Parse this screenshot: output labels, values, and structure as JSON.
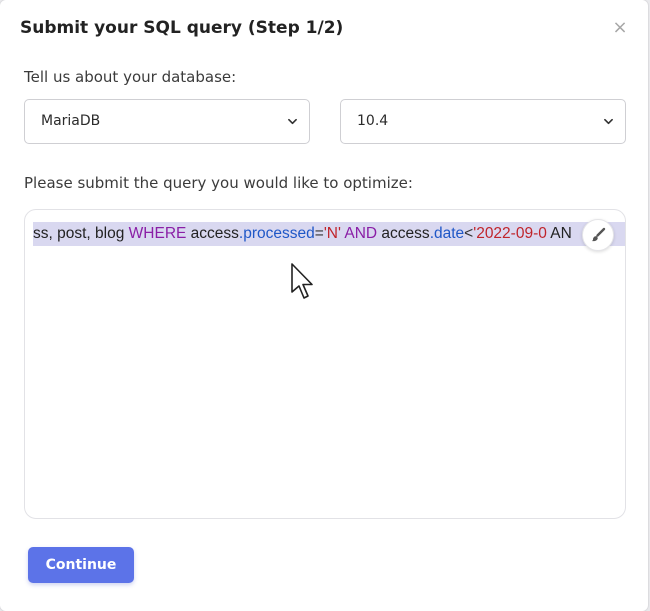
{
  "modal": {
    "title": "Submit your SQL query (Step 1/2)",
    "close_label": "×"
  },
  "database": {
    "label": "Tell us about your database:",
    "engine_selected": "MariaDB",
    "version_selected": "10.4"
  },
  "query": {
    "label": "Please submit the query you would like to optimize:",
    "tokens": [
      {
        "text": "ss, ",
        "kind": "plain"
      },
      {
        "text": "post, blog ",
        "kind": "plain"
      },
      {
        "text": "WHERE",
        "kind": "kw"
      },
      {
        "text": " access",
        "kind": "plain"
      },
      {
        "text": ".processed",
        "kind": "field"
      },
      {
        "text": "=",
        "kind": "op"
      },
      {
        "text": "'N'",
        "kind": "str"
      },
      {
        "text": " AND",
        "kind": "kw"
      },
      {
        "text": " access",
        "kind": "plain"
      },
      {
        "text": ".date",
        "kind": "field"
      },
      {
        "text": "<",
        "kind": "op"
      },
      {
        "text": "'2022-09-0",
        "kind": "str"
      },
      {
        "text": "  AN",
        "kind": "plain"
      }
    ]
  },
  "actions": {
    "continue_label": "Continue"
  },
  "colors": {
    "primary": "#5c73e8",
    "keyword": "#8a1ea6",
    "field": "#1f57c7",
    "string": "#c0242b",
    "selection": "#d9d8f0"
  },
  "icons": {
    "format": "brush-icon",
    "dropdown": "chevron-down-icon",
    "close": "close-icon"
  }
}
